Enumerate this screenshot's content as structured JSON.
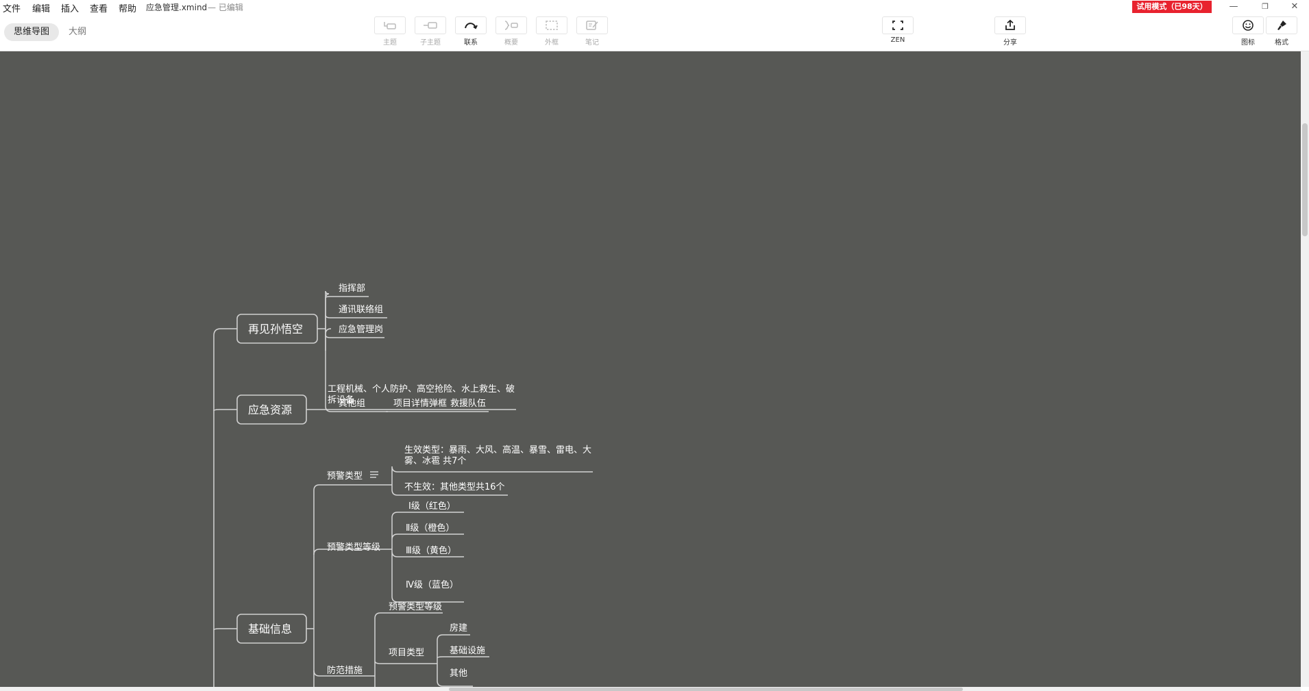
{
  "menu": {
    "file": "文件",
    "edit": "编辑",
    "insert": "插入",
    "view": "查看",
    "help": "帮助"
  },
  "document": {
    "title": "应急管理.xmind",
    "status": "— 已编辑"
  },
  "trial_badge": "试用模式（已98天）",
  "window_controls": {
    "minimize": "—",
    "restore": "❐",
    "close": "✕"
  },
  "view_tabs": {
    "mindmap": "思维导图",
    "outline": "大纲"
  },
  "toolbar": {
    "topic": "主题",
    "subtopic": "子主题",
    "relationship": "联系",
    "summary": "概要",
    "boundary": "外框",
    "note": "笔记",
    "zen": "ZEN",
    "share": "分享",
    "icon": "图标",
    "format": "格式"
  },
  "colors": {
    "canvas": "#575855",
    "trial_badge": "#e8222e",
    "branch": "#d4d4d4"
  },
  "mindmap": {
    "topics": {
      "t1": "再见孙悟空",
      "t2": "应急资源",
      "t3": "基础信息"
    },
    "t1_children": {
      "c1": "指挥部",
      "c2": "通讯联络组",
      "c3": "应急管理岗",
      "c4": "其他组",
      "c4a": "项目详情弹框",
      "c4b": "救援队伍"
    },
    "t2_children": {
      "c1_line1": "工程机械、个人防护、高空抢险、水上救生、破",
      "c1_line2": "拆设备"
    },
    "t3_children": {
      "warning_type": "预警类型",
      "warning_type_a_line1": "生效类型：暴雨、大风、高温、暴雪、雷电、大",
      "warning_type_a_line2": "雾、冰雹 共7个",
      "warning_type_b": "不生效：其他类型共16个",
      "warning_level": "预警类型等级",
      "level_1": "Ⅰ级（红色）",
      "level_2": "Ⅱ级（橙色）",
      "level_3": "Ⅲ级（黄色）",
      "level_4": "Ⅳ级（蓝色）",
      "prevention": "防范措施",
      "prevention_a": "预警类型等级",
      "prevention_b": "项目类型",
      "proj_1": "房建",
      "proj_2": "基础设施",
      "proj_3": "其他"
    }
  }
}
